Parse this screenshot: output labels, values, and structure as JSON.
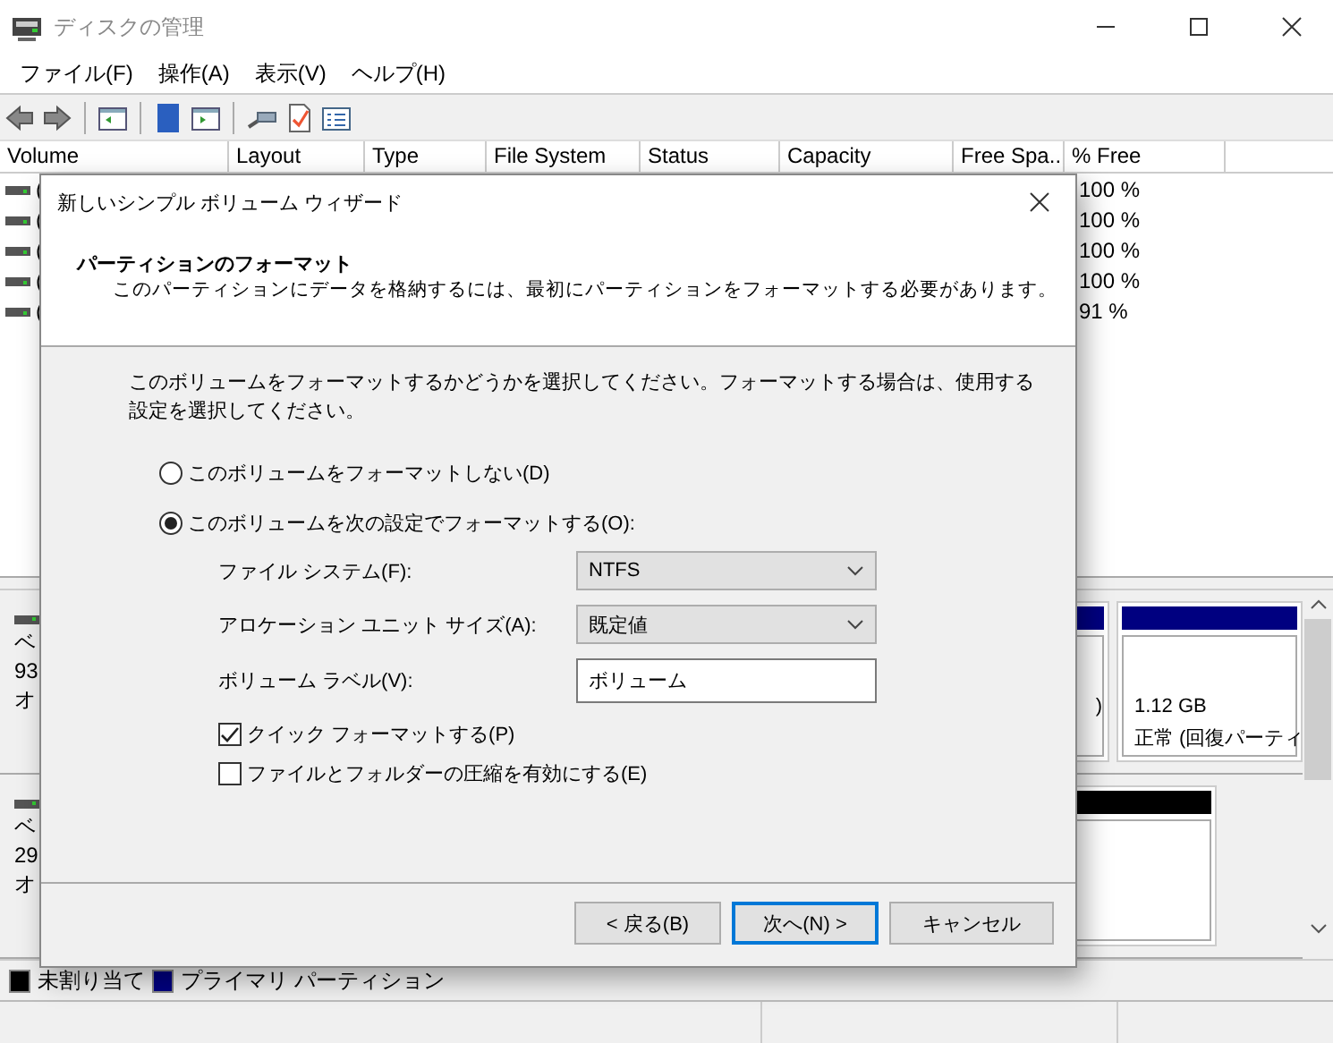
{
  "window": {
    "title": "ディスクの管理"
  },
  "menu": [
    "ファイル(F)",
    "操作(A)",
    "表示(V)",
    "ヘルプ(H)"
  ],
  "volume_table": {
    "columns": [
      "Volume",
      "Layout",
      "Type",
      "File System",
      "Status",
      "Capacity",
      "Free Spa...",
      "% Free"
    ],
    "rows": [
      {
        "volume": "(",
        "percent_free": "100 %"
      },
      {
        "volume": "(",
        "percent_free": "100 %"
      },
      {
        "volume": "(",
        "percent_free": "100 %"
      },
      {
        "volume": "(",
        "percent_free": "100 %"
      },
      {
        "volume": "(",
        "percent_free": "91 %"
      }
    ]
  },
  "disks": [
    {
      "label_lines": [
        "ベ",
        "93",
        "オ"
      ],
      "partitions": [
        {
          "color": "#000080",
          "lines": [
            ")"
          ]
        },
        {
          "color": "#000080",
          "lines": [
            "1.12 GB",
            "正常 (回復パーティ"
          ]
        }
      ]
    },
    {
      "label_lines": [
        "ベ",
        "29",
        "オ"
      ],
      "partitions": [
        {
          "color": "#000000"
        }
      ]
    }
  ],
  "legend": [
    {
      "label": "未割り当て",
      "color": "#000000"
    },
    {
      "label": "プライマリ パーティション",
      "color": "#000080"
    }
  ],
  "wizard": {
    "title": "新しいシンプル ボリューム ウィザード",
    "heading": "パーティションのフォーマット",
    "subheading": "このパーティションにデータを格納するには、最初にパーティションをフォーマットする必要があります。",
    "instructions": "このボリュームをフォーマットするかどうかを選択してください。フォーマットする場合は、使用する設定を選択してください。",
    "options": [
      {
        "label": "このボリュームをフォーマットしない(D)",
        "selected": false
      },
      {
        "label": "このボリュームを次の設定でフォーマットする(O):",
        "selected": true
      }
    ],
    "fields": [
      {
        "kind": "dropdown",
        "label": "ファイル システム(F):",
        "value": "NTFS"
      },
      {
        "kind": "dropdown",
        "label": "アロケーション ユニット サイズ(A):",
        "value": "既定値"
      },
      {
        "kind": "text",
        "label": "ボリューム ラベル(V):",
        "value": "ボリューム"
      }
    ],
    "checkboxes": [
      {
        "label": "クイック フォーマットする(P)",
        "checked": true
      },
      {
        "label": "ファイルとフォルダーの圧縮を有効にする(E)",
        "checked": false
      }
    ],
    "buttons": [
      {
        "label": "< 戻る(B)",
        "default": false
      },
      {
        "label": "次へ(N) >",
        "default": true
      },
      {
        "label": "キャンセル",
        "default": false
      }
    ]
  }
}
